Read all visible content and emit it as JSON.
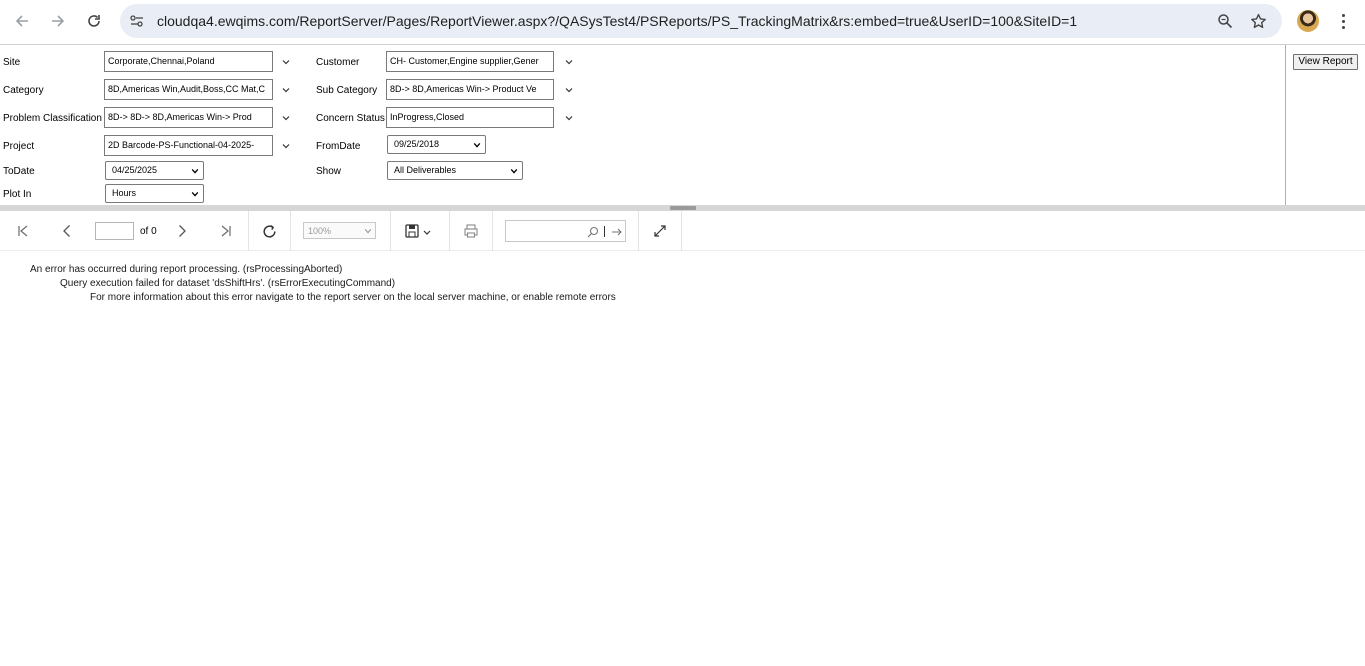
{
  "browser": {
    "url": "cloudqa4.ewqims.com/ReportServer/Pages/ReportViewer.aspx?/QASysTest4/PSReports/PS_TrackingMatrix&rs:embed=true&UserID=100&SiteID=1"
  },
  "params": {
    "site": {
      "label": "Site",
      "value": "Corporate,Chennai,Poland"
    },
    "customer": {
      "label": "Customer",
      "value": "CH- Customer,Engine supplier,Gener"
    },
    "category": {
      "label": "Category",
      "value": "8D,Americas Win,Audit,Boss,CC Mat,C"
    },
    "sub_category": {
      "label": "Sub Category",
      "value": "8D-> 8D,Americas Win-> Product Ve"
    },
    "problem_classification": {
      "label": "Problem Classification",
      "value": "8D-> 8D-> 8D,Americas Win-> Prod"
    },
    "concern_status": {
      "label": "Concern Status",
      "value": "InProgress,Closed"
    },
    "project": {
      "label": "Project",
      "value": "2D Barcode-PS-Functional-04-2025-"
    },
    "from_date": {
      "label": "FromDate",
      "value": "09/25/2018"
    },
    "to_date": {
      "label": "ToDate",
      "value": "04/25/2025"
    },
    "show": {
      "label": "Show",
      "value": "All Deliverables"
    },
    "plot_in": {
      "label": "Plot In",
      "value": "Hours"
    }
  },
  "view_report_label": "View Report",
  "toolbar": {
    "page_of": "of 0",
    "zoom": "100%"
  },
  "errors": [
    "An error has occurred during report processing. (rsProcessingAborted)",
    "Query execution failed for dataset 'dsShiftHrs'. (rsErrorExecutingCommand)",
    "For more information about this error navigate to the report server on the local server machine, or enable remote errors"
  ]
}
